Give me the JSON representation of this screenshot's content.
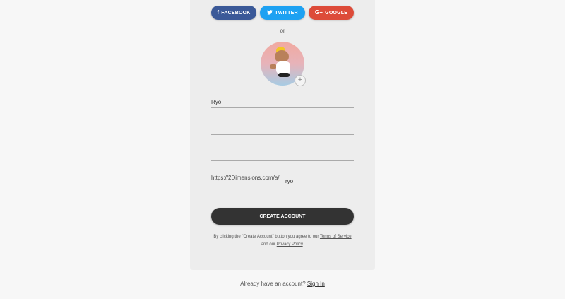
{
  "social": {
    "facebook": {
      "icon": "f",
      "label": "FACEBOOK",
      "color": "#3b5998"
    },
    "twitter": {
      "icon": "🐦",
      "label": "TWITTER",
      "color": "#1da1f2"
    },
    "google": {
      "icon": "G+",
      "label": "GOOGLE",
      "color": "#dd4b39"
    }
  },
  "divider_text": "or",
  "avatar": {
    "add_icon": "+"
  },
  "form": {
    "name_value": "Ryo",
    "email_value": "",
    "password_value": "",
    "url_prefix": "https://2Dimensions.com/a/",
    "username_value": "ryo"
  },
  "create_button": "CREATE ACCOUNT",
  "terms": {
    "prefix": "By clicking the \"Create Account\" button you agree to our",
    "terms_link": "Terms of Service",
    "middle": "and our",
    "privacy_link": "Privacy Policy",
    "suffix": "."
  },
  "footer": {
    "text": "Already have an account?",
    "signin_link": "Sign In"
  }
}
